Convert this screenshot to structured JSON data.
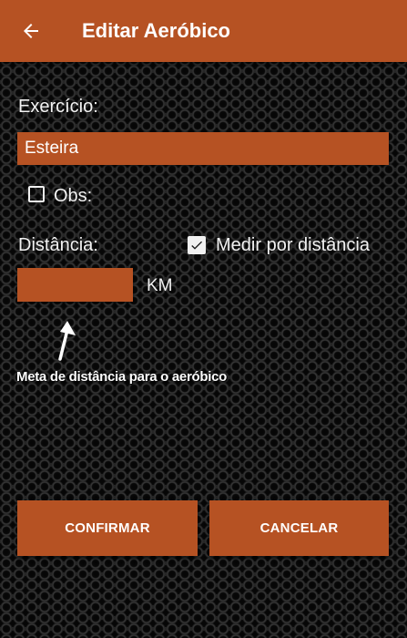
{
  "appbar": {
    "title": "Editar Aeróbico",
    "back_icon": "arrow-left-icon",
    "color": "#b65223"
  },
  "form": {
    "exercise_label": "Exercício:",
    "exercise_value": "Esteira",
    "obs_label": "Obs:",
    "obs_checked": false,
    "distance_label": "Distância:",
    "measure_by_distance_label": "Medir por distância",
    "measure_by_distance_checked": true,
    "distance_value": "",
    "distance_unit": "KM"
  },
  "hint": {
    "text": "Meta de distância para o aeróbico",
    "icon": "arrow-up-icon"
  },
  "actions": {
    "confirm_label": "CONFIRMAR",
    "cancel_label": "CANCELAR"
  }
}
